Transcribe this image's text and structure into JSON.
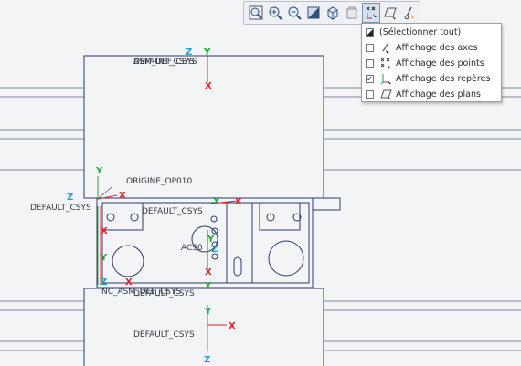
{
  "canvas": {
    "labels": {
      "top_csys": "ASM_DEF_CSYS",
      "top_csys_overlap": "DEFAULT_CSYS",
      "origine": "ORIGINE_OP010",
      "default_left": "DEFAULT_CSYS",
      "default_center": "DEFAULT_CSYS",
      "acs": "ACS0",
      "nc_asm": "NC_ASM_DEF_CSYS",
      "default_lower": "DEFAULT_CSYS",
      "default_bottom": "DEFAULT_CSYS"
    },
    "axis_letters": {
      "x": "X",
      "y": "Y",
      "z": "Z"
    }
  },
  "toolbar": {
    "buttons": [
      {
        "icon": "zoom-window-icon"
      },
      {
        "icon": "zoom-in-icon"
      },
      {
        "icon": "zoom-out-icon"
      },
      {
        "icon": "refit-icon"
      },
      {
        "icon": "display-style-icon"
      },
      {
        "icon": "saved-views-icon"
      },
      {
        "icon": "datum-display-filter-icon",
        "active": true
      },
      {
        "icon": "datum-planes-icon"
      },
      {
        "icon": "annotation-display-icon"
      }
    ]
  },
  "menu": {
    "items": [
      {
        "label": "(Sélectionner tout)",
        "checked": false,
        "partial": true
      },
      {
        "label": "Affichage des axes",
        "checked": false,
        "icon": "axis-icon"
      },
      {
        "label": "Affichage des points",
        "checked": false,
        "icon": "points-icon"
      },
      {
        "label": "Affichage des repères",
        "checked": true,
        "icon": "csys-icon"
      },
      {
        "label": "Affichage des plans",
        "checked": false,
        "icon": "plane-icon"
      }
    ]
  }
}
